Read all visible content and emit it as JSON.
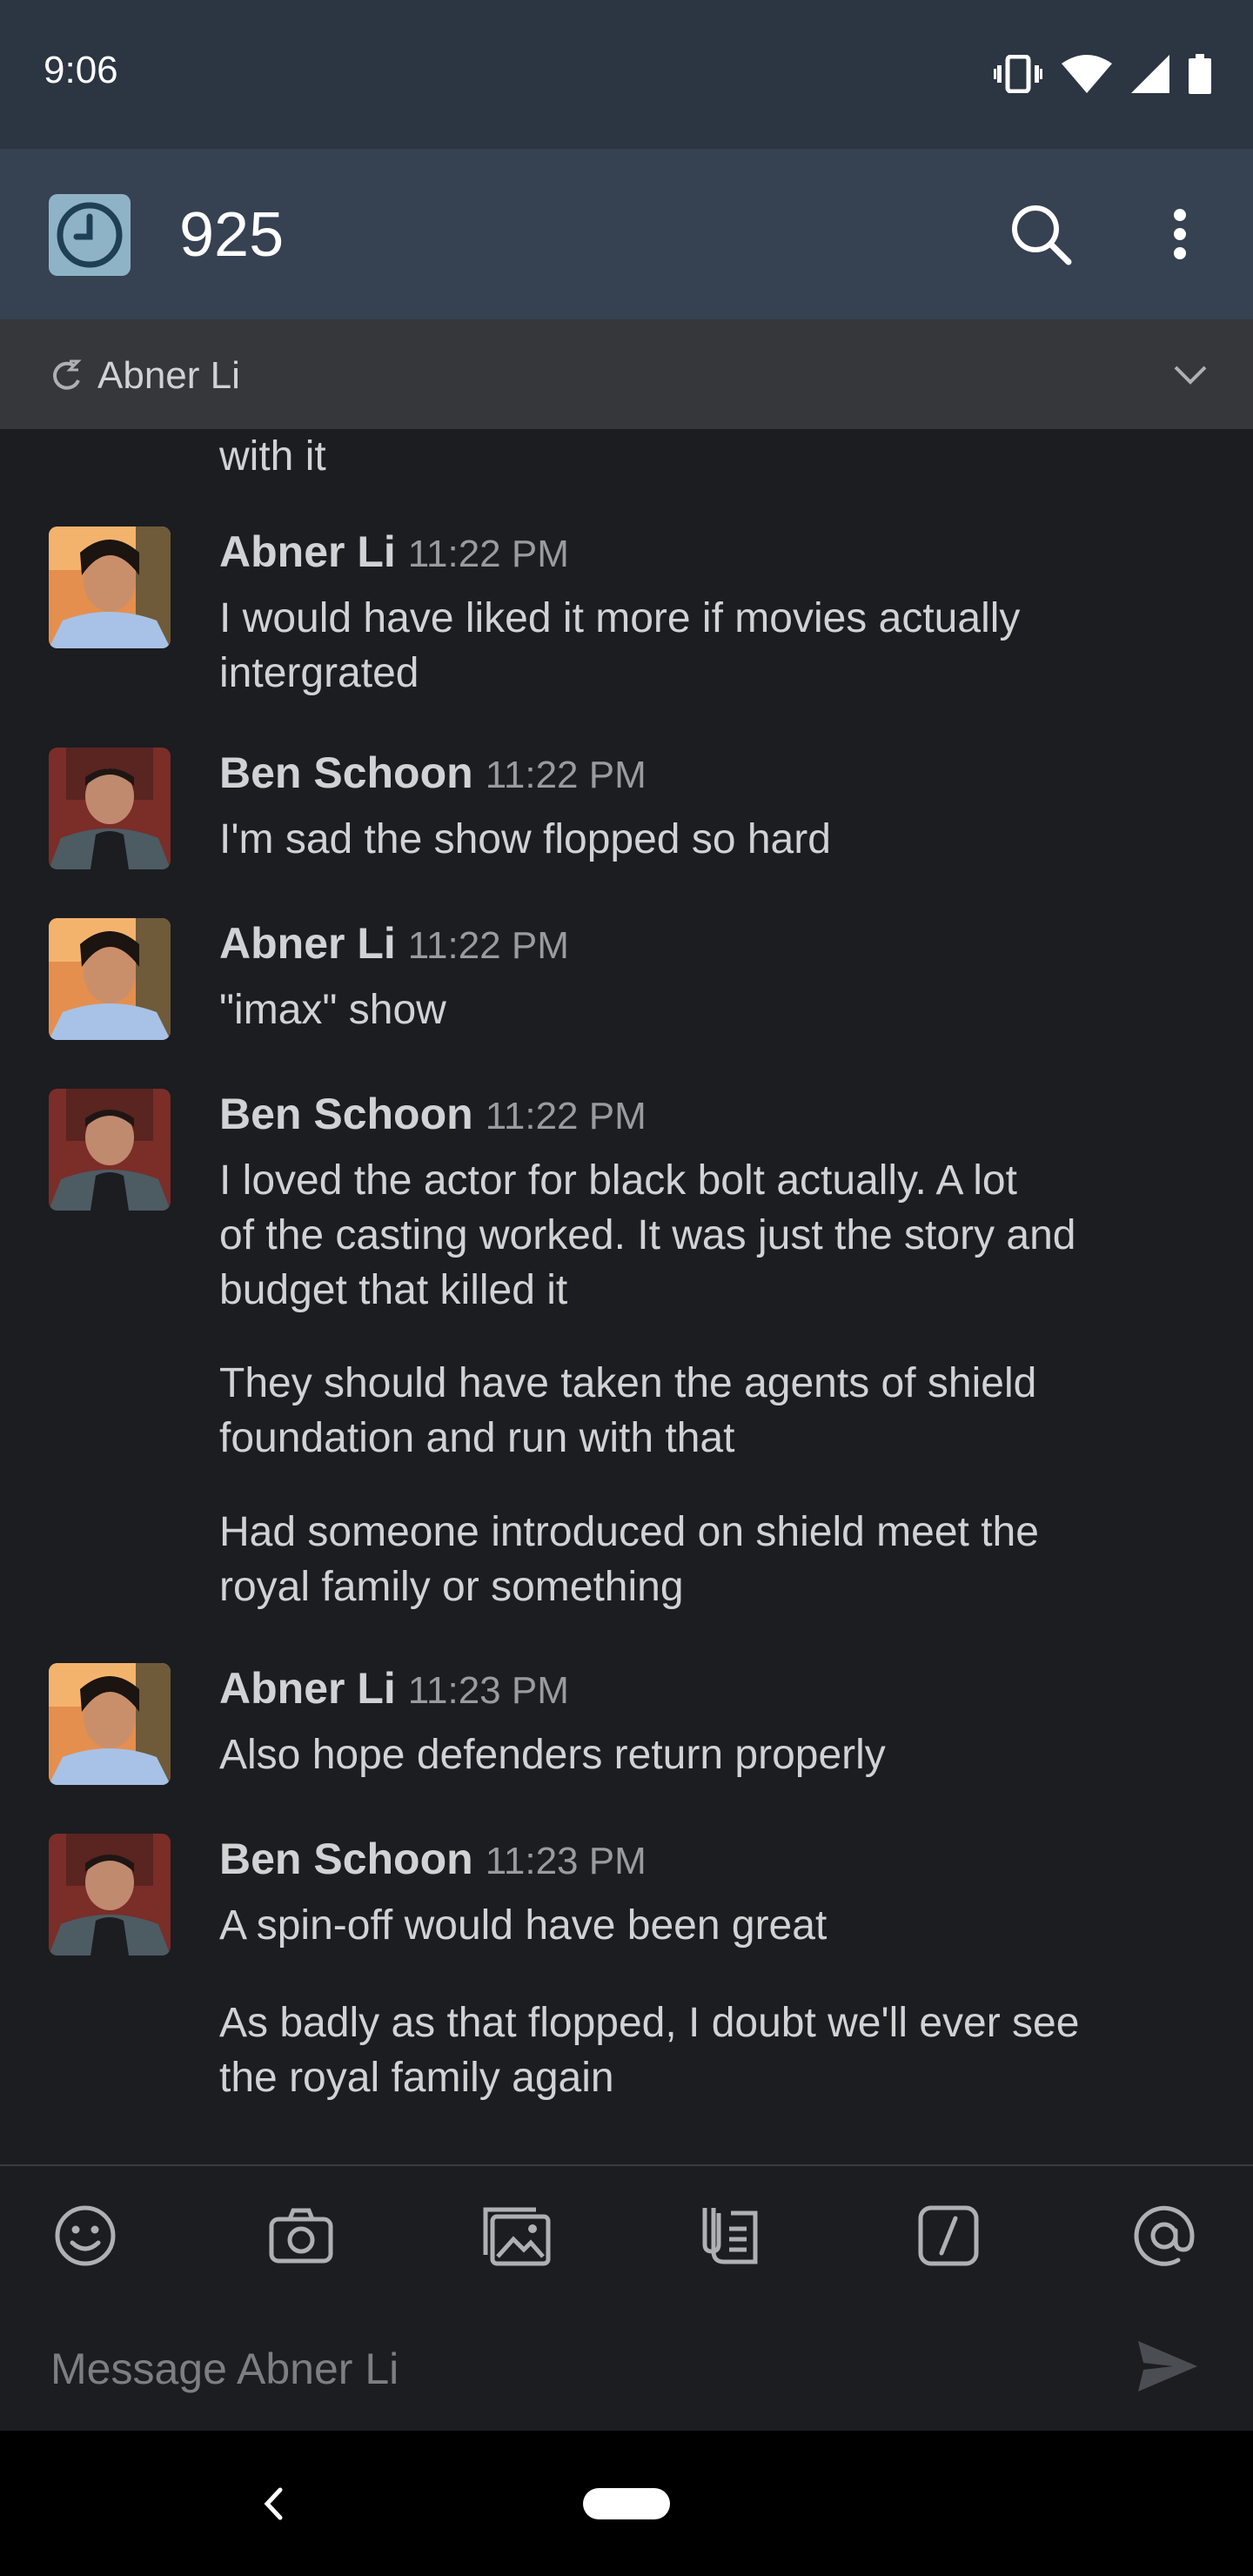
{
  "status_bar": {
    "time": "9:06"
  },
  "header": {
    "title": "925"
  },
  "channel": {
    "name": "Abner Li"
  },
  "messages": [
    {
      "continuation": "with it"
    },
    {
      "sender": "Abner Li",
      "time": "11:22 PM",
      "lines": [
        "I would have liked it more if movies actually",
        "intergrated"
      ]
    },
    {
      "sender": "Ben Schoon",
      "time": "11:22 PM",
      "lines": [
        "I'm sad the show flopped so hard"
      ]
    },
    {
      "sender": "Abner Li",
      "time": "11:22 PM",
      "lines": [
        "\"imax\" show"
      ]
    },
    {
      "sender": "Ben Schoon",
      "time": "11:22 PM",
      "lines": [
        "I loved the actor for black bolt actually. A lot",
        "of the casting worked. It was just the story and",
        "budget that killed it"
      ],
      "followups": [
        [
          "They should have taken the agents of shield",
          "foundation and run with that"
        ],
        [
          "Had someone introduced on shield meet the",
          "royal family or something"
        ]
      ]
    },
    {
      "sender": "Abner Li",
      "time": "11:23 PM",
      "lines": [
        "Also hope defenders return properly"
      ]
    },
    {
      "sender": "Ben Schoon",
      "time": "11:23 PM",
      "lines": [
        "A spin-off would have been great"
      ],
      "followups": [
        [
          "As badly as that flopped, I doubt we'll ever see",
          "the royal family again"
        ]
      ]
    }
  ],
  "composer": {
    "placeholder": "Message Abner Li",
    "tools": [
      "emoji-icon",
      "camera-icon",
      "gallery-icon",
      "file-icon",
      "slash-command-icon",
      "mention-icon"
    ]
  },
  "colors": {
    "background": "#1b1d21",
    "header": "#364152",
    "status_bar": "#2c3542",
    "channel_bar": "#35373b"
  }
}
